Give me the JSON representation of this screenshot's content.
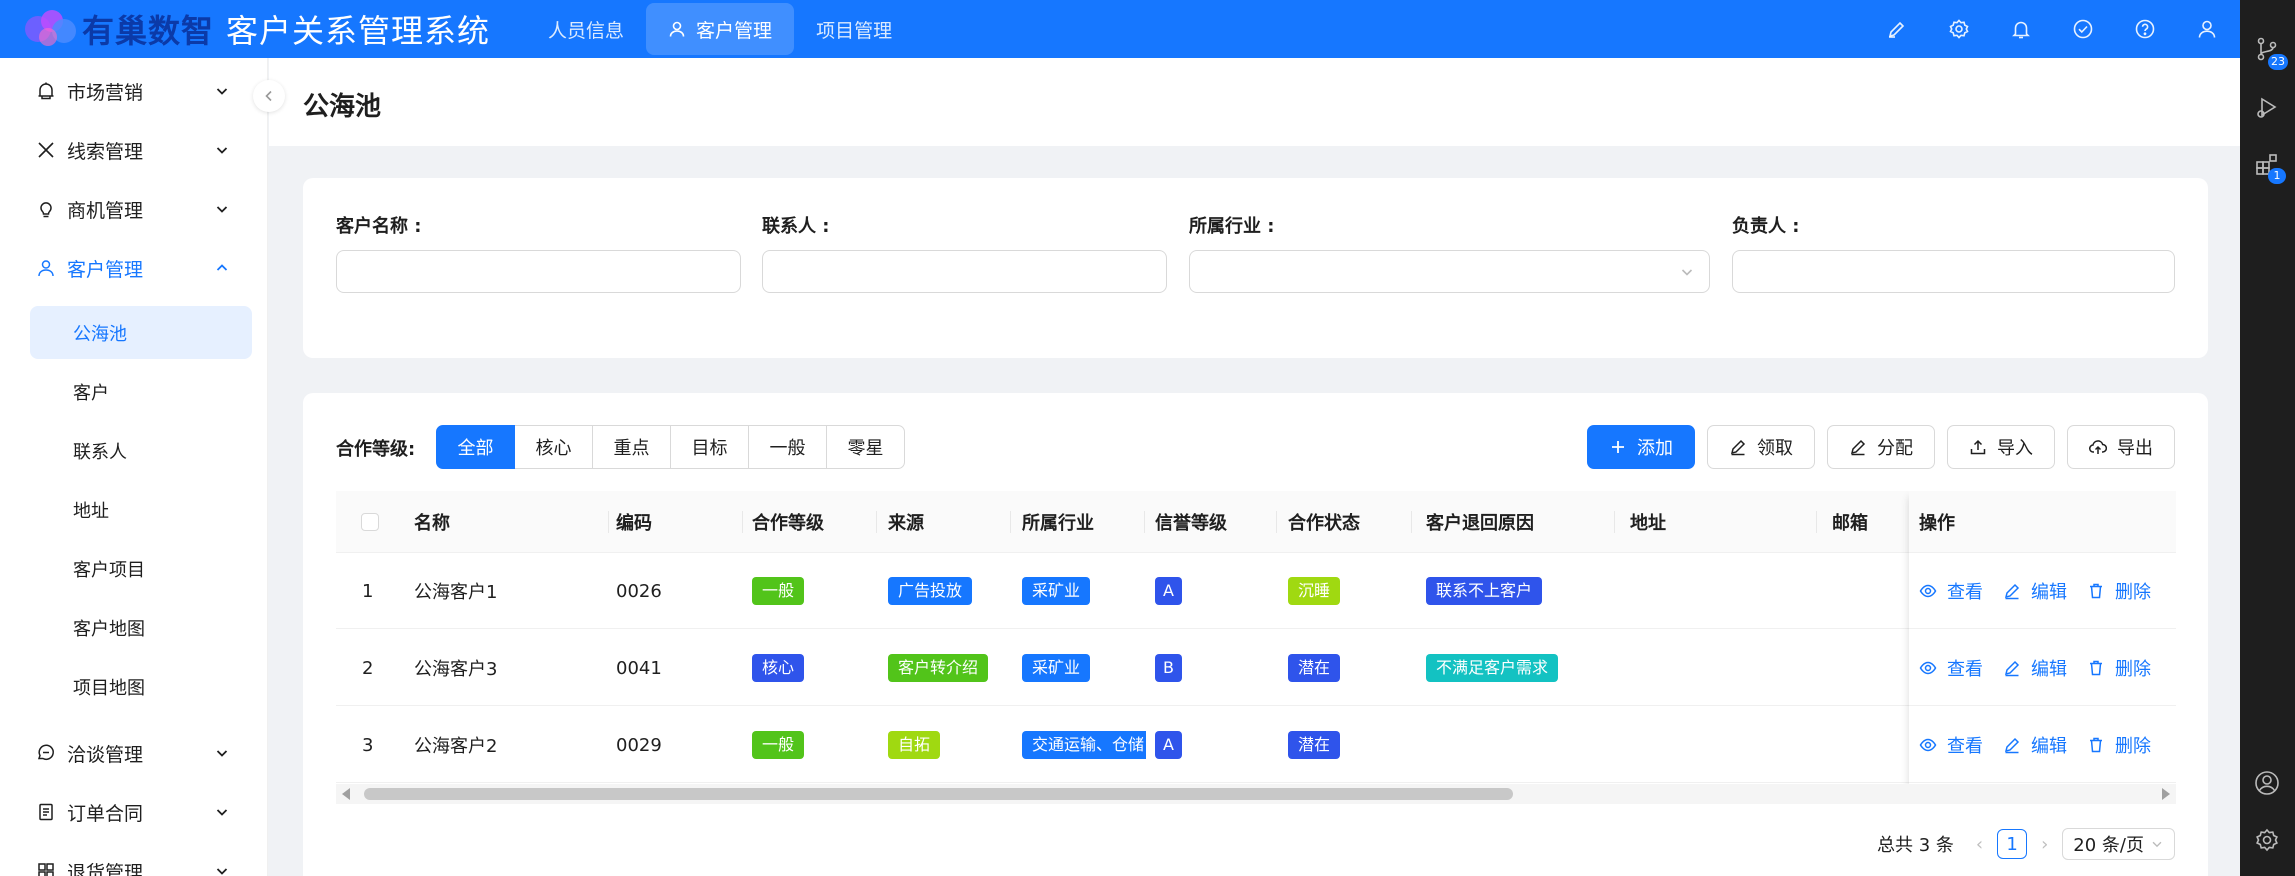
{
  "header": {
    "brand_text": "有巢数智",
    "app_title": "客户关系管理系统",
    "nav": [
      {
        "label": "人员信息"
      },
      {
        "label": "客户管理"
      },
      {
        "label": "项目管理"
      }
    ],
    "icons": [
      "brush-icon",
      "gear-icon",
      "bell-icon",
      "check-circle-icon",
      "help-icon",
      "user-icon"
    ],
    "accent_color": "#1677ff"
  },
  "rail": {
    "badges": [
      "23",
      "1"
    ]
  },
  "sidebar": {
    "items": [
      {
        "label": "市场营销"
      },
      {
        "label": "线索管理"
      },
      {
        "label": "商机管理"
      },
      {
        "label": "客户管理"
      },
      {
        "label": "洽谈管理"
      },
      {
        "label": "订单合同"
      },
      {
        "label": "退货管理"
      }
    ],
    "sub_items": [
      {
        "label": "公海池"
      },
      {
        "label": "客户"
      },
      {
        "label": "联系人"
      },
      {
        "label": "地址"
      },
      {
        "label": "客户项目"
      },
      {
        "label": "客户地图"
      },
      {
        "label": "项目地图"
      }
    ]
  },
  "page": {
    "title": "公海池"
  },
  "search": {
    "fields": [
      {
        "label": "客户名称 :",
        "value": ""
      },
      {
        "label": "联系人 :",
        "value": ""
      },
      {
        "label": "所属行业 :",
        "value": ""
      },
      {
        "label": "负责人 :",
        "value": ""
      }
    ]
  },
  "filter": {
    "label": "合作等级:",
    "options": [
      "全部",
      "核心",
      "重点",
      "目标",
      "一般",
      "零星"
    ],
    "selected": "全部"
  },
  "actions": {
    "add": "添加",
    "claim": "领取",
    "assign": "分配",
    "import": "导入",
    "export": "导出"
  },
  "table": {
    "columns": [
      "名称",
      "编码",
      "合作等级",
      "来源",
      "所属行业",
      "信誉等级",
      "合作状态",
      "客户退回原因",
      "地址",
      "邮箱",
      "操作"
    ],
    "rows": [
      {
        "index": "1",
        "name": "公海客户1",
        "code": "0026",
        "level": "一般",
        "source": "广告投放",
        "industry": "采矿业",
        "credit": "A",
        "status": "沉睡",
        "reason": "联系不上客户"
      },
      {
        "index": "2",
        "name": "公海客户3",
        "code": "0041",
        "level": "核心",
        "source": "客户转介绍",
        "industry": "采矿业",
        "credit": "B",
        "status": "潜在",
        "reason": "不满足客户需求"
      },
      {
        "index": "3",
        "name": "公海客户2",
        "code": "0029",
        "level": "一般",
        "source": "自拓",
        "industry": "交通运输、仓储",
        "credit": "A",
        "status": "潜在",
        "reason": ""
      }
    ],
    "row_actions": {
      "view": "查看",
      "edit": "编辑",
      "delete": "删除"
    },
    "tag_colors": {
      "一般": "#52c41a",
      "核心": "#2f54eb",
      "广告投放": "#1677ff",
      "客户转介绍": "#52c41a",
      "自拓": "#a0d911",
      "采矿业": "#1677ff",
      "交通运输、仓储": "#1677ff",
      "A": "#2f54eb",
      "B": "#2f54eb",
      "沉睡": "#a0d911",
      "潜在": "#2f54eb",
      "联系不上客户": "#2f54eb",
      "不满足客户需求": "#13c2c2"
    }
  },
  "pagination": {
    "total_text": "总共 3 条",
    "current_page": "1",
    "page_size": "20 条/页"
  }
}
